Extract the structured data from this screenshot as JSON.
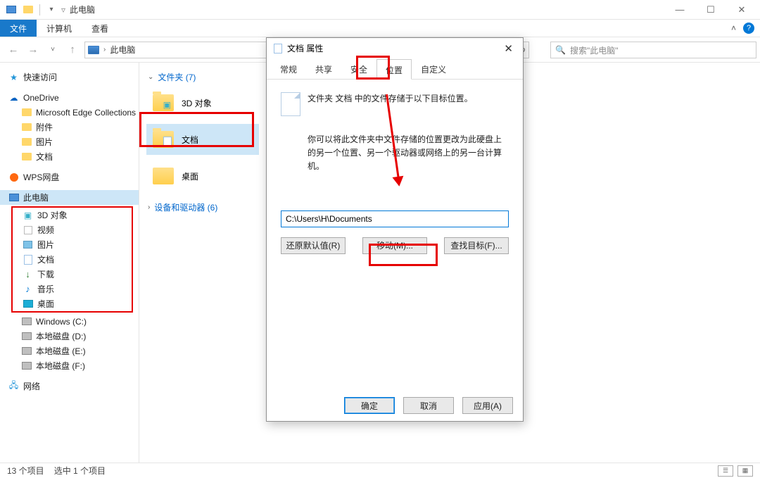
{
  "titlebar": {
    "title": "此电脑"
  },
  "menubar": {
    "file": "文件",
    "computer": "计算机",
    "view": "查看"
  },
  "nav": {
    "breadcrumb": "此电脑",
    "search_placeholder": "搜索\"此电脑\"",
    "refresh": "↻",
    "dd": "˅"
  },
  "sidebar": {
    "quick": "快速访问",
    "onedrive": "OneDrive",
    "edge": "Microsoft Edge Collections",
    "attach": "附件",
    "pic": "图片",
    "doc": "文档",
    "wps": "WPS网盘",
    "thispc": "此电脑",
    "box": {
      "obj3d": "3D 对象",
      "video": "视频",
      "pic": "图片",
      "doc": "文档",
      "dl": "下载",
      "music": "音乐",
      "desk": "桌面"
    },
    "cdrive": "Windows (C:)",
    "ddrive": "本地磁盘 (D:)",
    "edrive": "本地磁盘 (E:)",
    "fdrive": "本地磁盘 (F:)",
    "network": "网络"
  },
  "content": {
    "folders_header": "文件夹 (7)",
    "devices_header": "设备和驱动器 (6)",
    "items": {
      "obj3d": "3D 对象",
      "doc": "文档",
      "desk": "桌面"
    }
  },
  "dialog": {
    "title": "文档 属性",
    "tabs": {
      "general": "常规",
      "share": "共享",
      "security": "安全",
      "location": "位置",
      "custom": "自定义"
    },
    "line1": "文件夹 文档 中的文件存储于以下目标位置。",
    "line2": "你可以将此文件夹中文件存储的位置更改为此硬盘上的另一个位置、另一个驱动器或网络上的另一台计算机。",
    "path": "C:\\Users\\H\\Documents",
    "restore": "还原默认值(R)",
    "move": "移动(M)...",
    "find": "查找目标(F)...",
    "ok": "确定",
    "cancel": "取消",
    "apply": "应用(A)"
  },
  "status": {
    "count": "13 个项目",
    "sel": "选中 1 个项目"
  }
}
